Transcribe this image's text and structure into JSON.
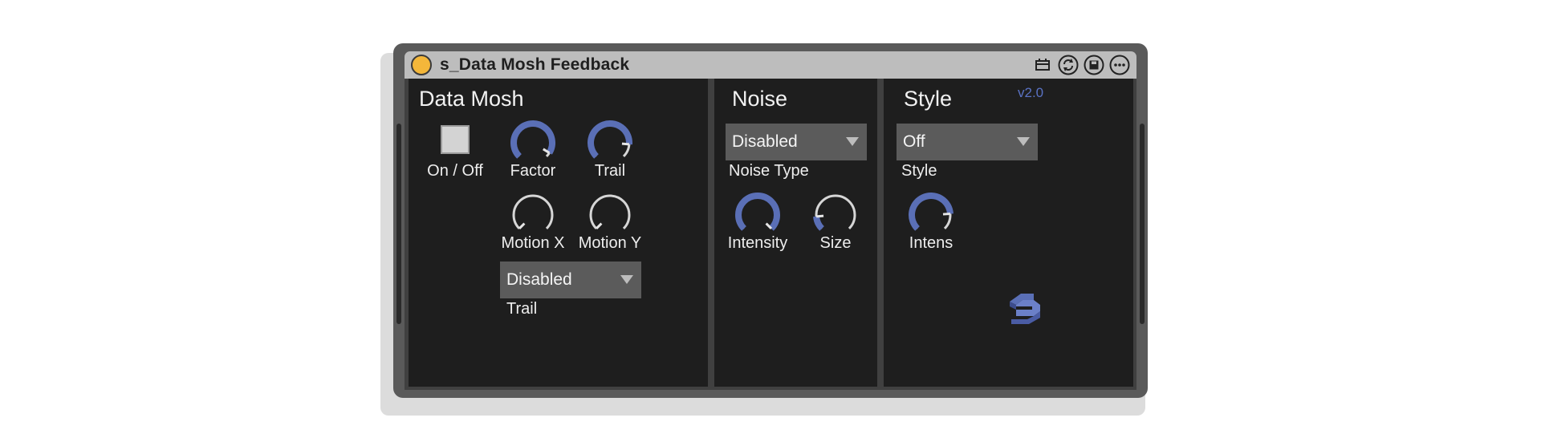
{
  "device": {
    "title": "s_Data Mosh Feedback",
    "accent_color": "#5a6fb6",
    "fold_button_color": "#f4b73a",
    "toolbar_icons": [
      "map-icon",
      "hot-swap-icon",
      "save-preset-icon",
      "more-icon"
    ]
  },
  "data_mosh": {
    "title": "Data Mosh",
    "toggle_label": "On / Off",
    "toggle_on": false,
    "knobs": [
      {
        "label": "Factor",
        "value": 0.95
      },
      {
        "label": "Trail",
        "value": 0.85
      },
      {
        "label": "Motion X",
        "value": 0.0
      },
      {
        "label": "Motion Y",
        "value": 0.0
      }
    ],
    "trail_dropdown": {
      "value": "Disabled",
      "label": "Trail"
    }
  },
  "noise": {
    "title": "Noise",
    "type_dropdown": {
      "value": "Disabled",
      "label": "Noise Type"
    },
    "knobs": [
      {
        "label": "Intensity",
        "value": 1.0
      },
      {
        "label": "Size",
        "value": 0.15
      }
    ]
  },
  "style": {
    "title": "Style",
    "version": "v2.0",
    "style_dropdown": {
      "value": "Off",
      "label": "Style"
    },
    "knobs": [
      {
        "label": "Intens",
        "value": 0.82
      }
    ]
  }
}
